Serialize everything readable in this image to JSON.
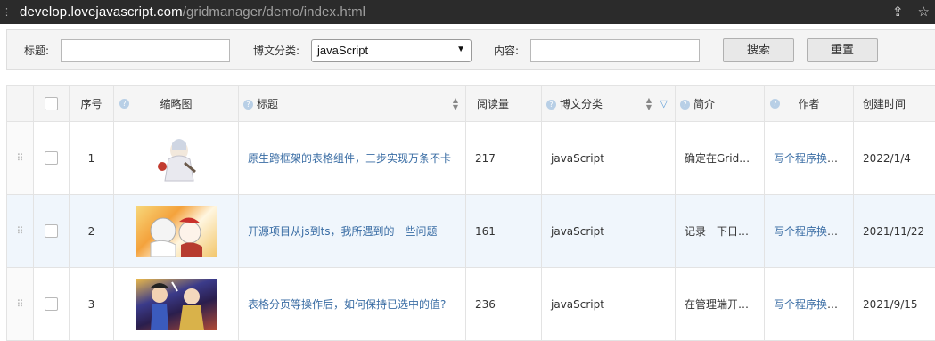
{
  "browser": {
    "url_host": "develop.lovejavascript.com",
    "url_path": "/gridmanager/demo/index.html"
  },
  "search": {
    "title_label": "标题:",
    "title_value": "",
    "category_label": "博文分类:",
    "category_selected": "javaScript",
    "content_label": "内容:",
    "content_value": "",
    "search_button": "搜索",
    "reset_button": "重置"
  },
  "table": {
    "headers": {
      "index": "序号",
      "thumbnail": "缩略图",
      "title": "标题",
      "reads": "阅读量",
      "category": "博文分类",
      "summary": "简介",
      "author": "作者",
      "created": "创建时间"
    },
    "rows": [
      {
        "index": "1",
        "title": "原生跨框架的表格组件，三步实现万条不卡",
        "reads": "217",
        "category": "javaScript",
        "summary": "确定在Grid…",
        "author": "写个程序换个饼…",
        "created": "2022/1/4"
      },
      {
        "index": "2",
        "title": "开源项目从js到ts，我所遇到的一些问题",
        "reads": "161",
        "category": "javaScript",
        "summary": "记录一下日…",
        "author": "写个程序换个饼…",
        "created": "2021/11/22"
      },
      {
        "index": "3",
        "title": "表格分页等操作后，如何保持已选中的值?",
        "reads": "236",
        "category": "javaScript",
        "summary": "在管理端开…",
        "author": "写个程序换个饼…",
        "created": "2021/9/15"
      }
    ]
  }
}
